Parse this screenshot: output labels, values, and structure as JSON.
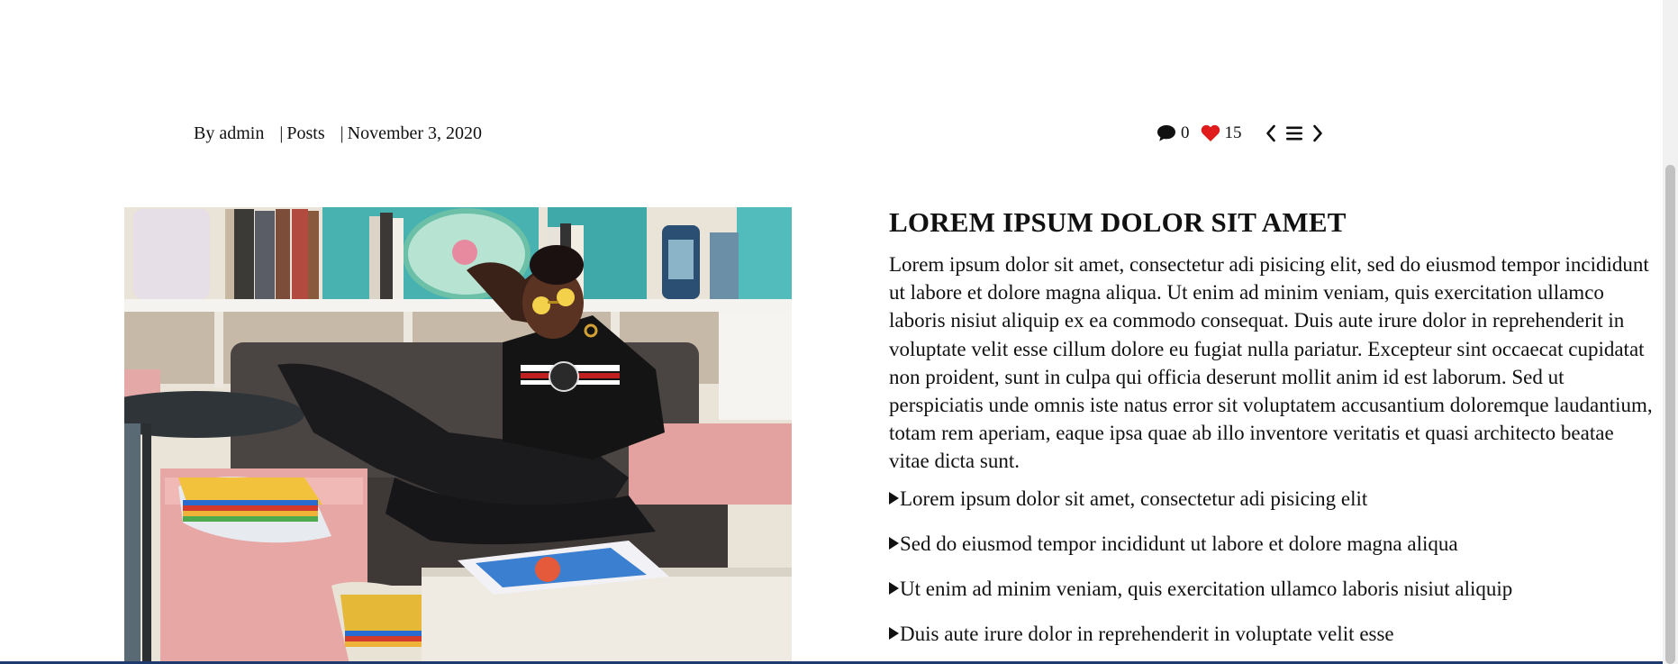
{
  "meta": {
    "author": "By admin",
    "category_sep": "|",
    "category": "Posts",
    "date_sep": "|",
    "date": "November 3, 2020",
    "comments_icon": "speech-bubble-icon",
    "comments_count": "0",
    "likes_icon": "heart-icon",
    "likes_count": "15",
    "prev_icon": "chevron-left-icon",
    "grid_icon": "menu-lines-icon",
    "next_icon": "chevron-right-icon",
    "like_color": "#e01b1b"
  },
  "article": {
    "title": "LOREM IPSUM DOLOR SIT AMET",
    "body": "Lorem ipsum dolor sit amet, consectetur adi pisicing elit, sed do eiusmod tempor incididunt ut labore et dolore magna aliqua. Ut enim ad minim veniam, quis exercitation ullamco laboris nisiut aliquip ex ea commodo consequat. Duis aute irure dolor in reprehenderit in voluptate velit esse cillum dolore eu fugiat nulla pariatur. Excepteur sint occaecat cupidatat non proident, sunt in culpa qui officia deserunt mollit anim id est laborum. Sed ut perspiciatis unde omnis iste natus error sit voluptatem accusantium doloremque laudantium, totam rem aperiam, eaque ipsa quae ab illo inventore veritatis et quasi architecto beatae vitae dicta sunt.",
    "bullets": [
      "Lorem ipsum dolor sit amet, consectetur adi pisicing elit",
      "Sed do eiusmod tempor incididunt ut labore et dolore magna aliqua",
      "Ut enim ad minim veniam, quis exercitation ullamco laboris nisiut aliquip",
      "Duis aute irure dolor in reprehenderit in voluptate velit esse"
    ]
  }
}
